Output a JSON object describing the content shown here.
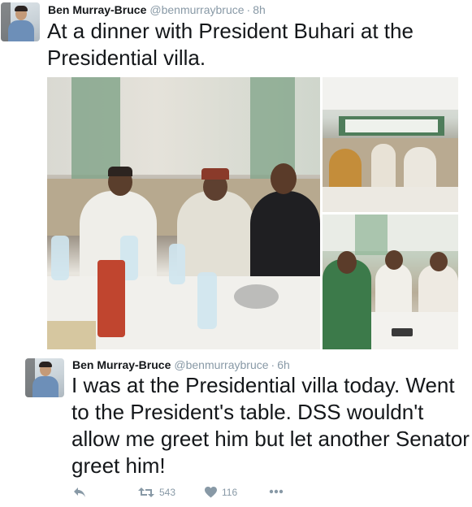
{
  "tweets": [
    {
      "name": "Ben Murray-Bruce",
      "handle": "@benmurraybruce",
      "separator": "·",
      "time": "8h",
      "text": "At a dinner with President Buhari at the Presidential villa."
    },
    {
      "name": "Ben Murray-Bruce",
      "handle": "@benmurraybruce",
      "separator": "·",
      "time": "6h",
      "text": "I was at the Presidential villa today. Went to the President's table. DSS wouldn't allow me greet him but let another Senator greet him!",
      "actions": {
        "reply_icon": "reply-icon",
        "retweet_icon": "retweet-icon",
        "retweet_count": "543",
        "like_icon": "heart-icon",
        "like_count": "116",
        "more_icon": "more-icon"
      }
    }
  ],
  "colors": {
    "text": "#14171a",
    "muted": "#8899a6",
    "background": "#ffffff"
  }
}
